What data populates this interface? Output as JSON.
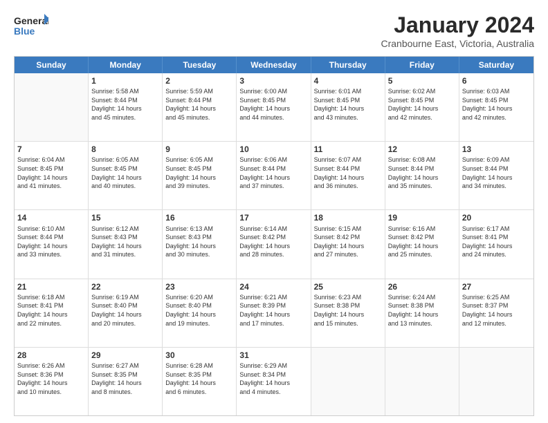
{
  "logo": {
    "line1": "General",
    "line2": "Blue"
  },
  "title": "January 2024",
  "subtitle": "Cranbourne East, Victoria, Australia",
  "header_days": [
    "Sunday",
    "Monday",
    "Tuesday",
    "Wednesday",
    "Thursday",
    "Friday",
    "Saturday"
  ],
  "rows": [
    [
      {
        "day": "",
        "info": ""
      },
      {
        "day": "1",
        "info": "Sunrise: 5:58 AM\nSunset: 8:44 PM\nDaylight: 14 hours\nand 45 minutes."
      },
      {
        "day": "2",
        "info": "Sunrise: 5:59 AM\nSunset: 8:44 PM\nDaylight: 14 hours\nand 45 minutes."
      },
      {
        "day": "3",
        "info": "Sunrise: 6:00 AM\nSunset: 8:45 PM\nDaylight: 14 hours\nand 44 minutes."
      },
      {
        "day": "4",
        "info": "Sunrise: 6:01 AM\nSunset: 8:45 PM\nDaylight: 14 hours\nand 43 minutes."
      },
      {
        "day": "5",
        "info": "Sunrise: 6:02 AM\nSunset: 8:45 PM\nDaylight: 14 hours\nand 42 minutes."
      },
      {
        "day": "6",
        "info": "Sunrise: 6:03 AM\nSunset: 8:45 PM\nDaylight: 14 hours\nand 42 minutes."
      }
    ],
    [
      {
        "day": "7",
        "info": "Sunrise: 6:04 AM\nSunset: 8:45 PM\nDaylight: 14 hours\nand 41 minutes."
      },
      {
        "day": "8",
        "info": "Sunrise: 6:05 AM\nSunset: 8:45 PM\nDaylight: 14 hours\nand 40 minutes."
      },
      {
        "day": "9",
        "info": "Sunrise: 6:05 AM\nSunset: 8:45 PM\nDaylight: 14 hours\nand 39 minutes."
      },
      {
        "day": "10",
        "info": "Sunrise: 6:06 AM\nSunset: 8:44 PM\nDaylight: 14 hours\nand 37 minutes."
      },
      {
        "day": "11",
        "info": "Sunrise: 6:07 AM\nSunset: 8:44 PM\nDaylight: 14 hours\nand 36 minutes."
      },
      {
        "day": "12",
        "info": "Sunrise: 6:08 AM\nSunset: 8:44 PM\nDaylight: 14 hours\nand 35 minutes."
      },
      {
        "day": "13",
        "info": "Sunrise: 6:09 AM\nSunset: 8:44 PM\nDaylight: 14 hours\nand 34 minutes."
      }
    ],
    [
      {
        "day": "14",
        "info": "Sunrise: 6:10 AM\nSunset: 8:44 PM\nDaylight: 14 hours\nand 33 minutes."
      },
      {
        "day": "15",
        "info": "Sunrise: 6:12 AM\nSunset: 8:43 PM\nDaylight: 14 hours\nand 31 minutes."
      },
      {
        "day": "16",
        "info": "Sunrise: 6:13 AM\nSunset: 8:43 PM\nDaylight: 14 hours\nand 30 minutes."
      },
      {
        "day": "17",
        "info": "Sunrise: 6:14 AM\nSunset: 8:42 PM\nDaylight: 14 hours\nand 28 minutes."
      },
      {
        "day": "18",
        "info": "Sunrise: 6:15 AM\nSunset: 8:42 PM\nDaylight: 14 hours\nand 27 minutes."
      },
      {
        "day": "19",
        "info": "Sunrise: 6:16 AM\nSunset: 8:42 PM\nDaylight: 14 hours\nand 25 minutes."
      },
      {
        "day": "20",
        "info": "Sunrise: 6:17 AM\nSunset: 8:41 PM\nDaylight: 14 hours\nand 24 minutes."
      }
    ],
    [
      {
        "day": "21",
        "info": "Sunrise: 6:18 AM\nSunset: 8:41 PM\nDaylight: 14 hours\nand 22 minutes."
      },
      {
        "day": "22",
        "info": "Sunrise: 6:19 AM\nSunset: 8:40 PM\nDaylight: 14 hours\nand 20 minutes."
      },
      {
        "day": "23",
        "info": "Sunrise: 6:20 AM\nSunset: 8:40 PM\nDaylight: 14 hours\nand 19 minutes."
      },
      {
        "day": "24",
        "info": "Sunrise: 6:21 AM\nSunset: 8:39 PM\nDaylight: 14 hours\nand 17 minutes."
      },
      {
        "day": "25",
        "info": "Sunrise: 6:23 AM\nSunset: 8:38 PM\nDaylight: 14 hours\nand 15 minutes."
      },
      {
        "day": "26",
        "info": "Sunrise: 6:24 AM\nSunset: 8:38 PM\nDaylight: 14 hours\nand 13 minutes."
      },
      {
        "day": "27",
        "info": "Sunrise: 6:25 AM\nSunset: 8:37 PM\nDaylight: 14 hours\nand 12 minutes."
      }
    ],
    [
      {
        "day": "28",
        "info": "Sunrise: 6:26 AM\nSunset: 8:36 PM\nDaylight: 14 hours\nand 10 minutes."
      },
      {
        "day": "29",
        "info": "Sunrise: 6:27 AM\nSunset: 8:35 PM\nDaylight: 14 hours\nand 8 minutes."
      },
      {
        "day": "30",
        "info": "Sunrise: 6:28 AM\nSunset: 8:35 PM\nDaylight: 14 hours\nand 6 minutes."
      },
      {
        "day": "31",
        "info": "Sunrise: 6:29 AM\nSunset: 8:34 PM\nDaylight: 14 hours\nand 4 minutes."
      },
      {
        "day": "",
        "info": ""
      },
      {
        "day": "",
        "info": ""
      },
      {
        "day": "",
        "info": ""
      }
    ]
  ]
}
